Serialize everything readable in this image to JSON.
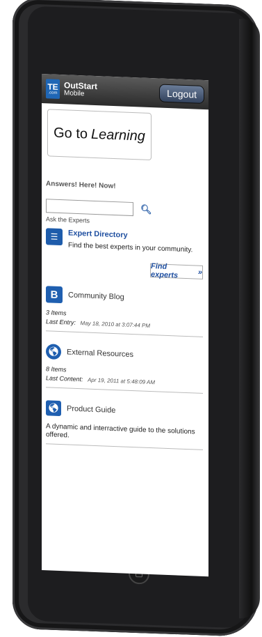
{
  "header": {
    "brand_name": "OutStart",
    "brand_sub": "Mobile",
    "logo_text": "TE",
    "logo_sub": ".com",
    "logout_label": "Logout"
  },
  "hero": {
    "prefix": "Go to",
    "emphasis": "Learning"
  },
  "tagline": "Answers! Here! Now!",
  "search": {
    "value": "",
    "placeholder": ""
  },
  "ask_label": "Ask the Experts",
  "expert": {
    "title": "Expert Directory",
    "description": "Find the best experts in your community.",
    "button_label": "Find experts",
    "button_arrow": "»"
  },
  "blog": {
    "title": "Community Blog",
    "items": "3 Items",
    "last_label": "Last Entry:",
    "last_value": "May 18, 2010 at 3:07:44 PM"
  },
  "external": {
    "title": "External Resources",
    "items": "8 Items",
    "last_label": "Last Content:",
    "last_value": "Apr 19, 2011 at 5:48:09 AM"
  },
  "guide": {
    "title": "Product Guide",
    "description": "A dynamic and interractive guide to the solutions offered."
  },
  "colors": {
    "accent": "#1f5fb0",
    "topbar": "#2b2b2b"
  }
}
